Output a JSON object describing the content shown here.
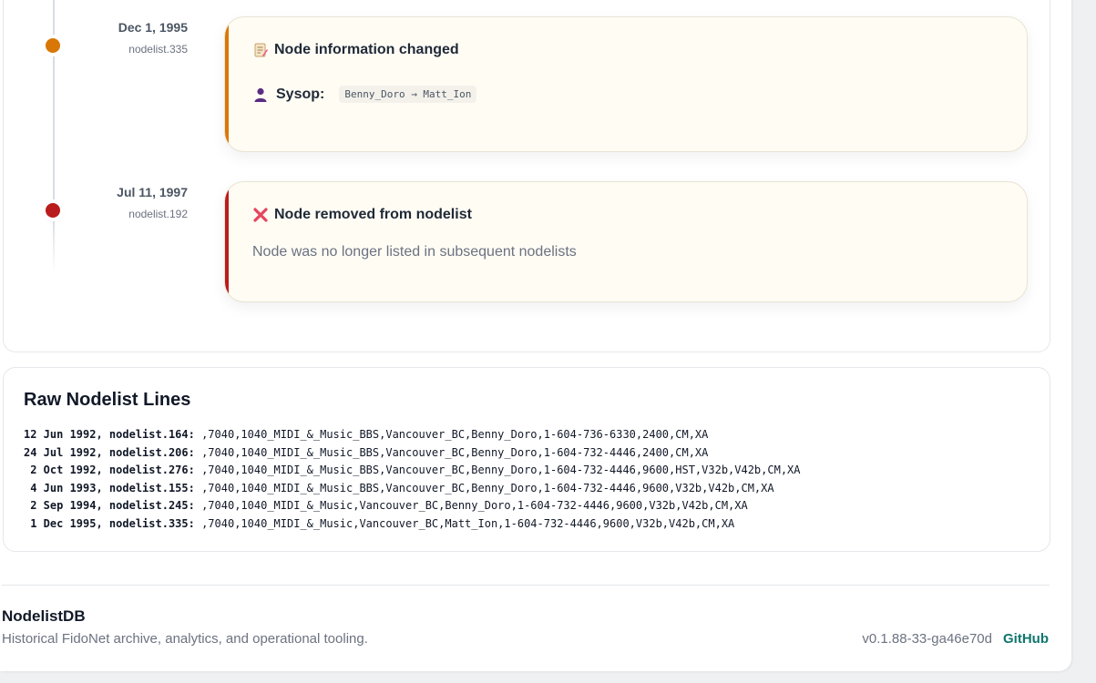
{
  "timeline": {
    "events": [
      {
        "date": "Dec 1, 1995",
        "file": "nodelist.335",
        "dot_color": "#d97706",
        "accent_color": "#d97706",
        "title": "Node information changed",
        "title_icon": "memo-icon",
        "detail_icon": "person-icon",
        "detail_label": "Sysop:",
        "detail_value": "Benny_Doro → Matt_Ion"
      },
      {
        "date": "Jul 11, 1997",
        "file": "nodelist.192",
        "dot_color": "#b91c1c",
        "accent_color": "#b91c1c",
        "title": "Node removed from nodelist",
        "title_icon": "cross-mark-icon",
        "description": "Node was no longer listed in subsequent nodelists"
      }
    ]
  },
  "raw": {
    "title": "Raw Nodelist Lines",
    "lines": [
      {
        "prefix": "12 Jun 1992, nodelist.164:",
        "text": " ,7040,1040_MIDI_&_Music_BBS,Vancouver_BC,Benny_Doro,1-604-736-6330,2400,CM,XA"
      },
      {
        "prefix": "24 Jul 1992, nodelist.206:",
        "text": " ,7040,1040_MIDI_&_Music_BBS,Vancouver_BC,Benny_Doro,1-604-732-4446,2400,CM,XA"
      },
      {
        "prefix": " 2 Oct 1992, nodelist.276:",
        "text": " ,7040,1040_MIDI_&_Music_BBS,Vancouver_BC,Benny_Doro,1-604-732-4446,9600,HST,V32b,V42b,CM,XA"
      },
      {
        "prefix": " 4 Jun 1993, nodelist.155:",
        "text": " ,7040,1040_MIDI_&_Music_BBS,Vancouver_BC,Benny_Doro,1-604-732-4446,9600,V32b,V42b,CM,XA"
      },
      {
        "prefix": " 2 Sep 1994, nodelist.245:",
        "text": " ,7040,1040_MIDI_&_Music,Vancouver_BC,Benny_Doro,1-604-732-4446,9600,V32b,V42b,CM,XA"
      },
      {
        "prefix": " 1 Dec 1995, nodelist.335:",
        "text": " ,7040,1040_MIDI_&_Music,Vancouver_BC,Matt_Ion,1-604-732-4446,9600,V32b,V42b,CM,XA"
      }
    ]
  },
  "footer": {
    "brand": "NodelistDB",
    "tagline": "Historical FidoNet archive, analytics, and operational tooling.",
    "version": "v0.1.88-33-ga46e70d",
    "github_label": "GitHub"
  }
}
